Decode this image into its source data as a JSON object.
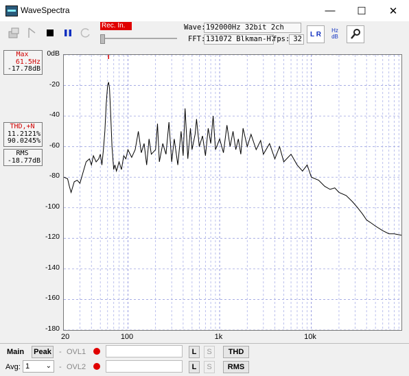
{
  "window": {
    "title": "WaveSpectra",
    "minimize": "—",
    "maximize": "☐",
    "close": "✕"
  },
  "toolbar": {
    "rec_in_label": "Rec. In.",
    "wave_label": "Wave:",
    "wave_value": "192000Hz 32bit 2ch",
    "fft_label": "FFT:",
    "fft_value": "131072 Blkman-H7",
    "fps_label": "fps:",
    "fps_value": "32",
    "lr_label": "L R",
    "hzdb_label": "Hz dB"
  },
  "side": {
    "max_header": "Max",
    "max_freq": "61.5Hz",
    "max_level": "-17.78dB",
    "thd_header": "THD,+N",
    "thd_value1": "11.2121%",
    "thd_value2": "90.0245%",
    "rms_header": "RMS",
    "rms_value": "-18.77dB"
  },
  "bottom": {
    "main_label": "Main",
    "peak_label": "Peak",
    "avg_label": "Avg:",
    "avg_value": "1",
    "dash1": "-",
    "dash2": "-",
    "ovl1_label": "OVL1",
    "ovl2_label": "OVL2",
    "l_label1": "L",
    "s_label1": "S",
    "l_label2": "L",
    "s_label2": "S",
    "thd_label": "THD",
    "rms_label": "RMS"
  },
  "chart_data": {
    "type": "line",
    "title": "",
    "xlabel": "",
    "ylabel": "",
    "x_scale": "log",
    "xlim": [
      20,
      96000
    ],
    "ylim": [
      -180,
      0
    ],
    "x_tick_labels": [
      "20",
      "100",
      "1k",
      "10k"
    ],
    "x_ticks": [
      20,
      100,
      1000,
      10000
    ],
    "y_ticks": [
      0,
      -20,
      -40,
      -60,
      -80,
      -100,
      -120,
      -140,
      -160,
      -180
    ],
    "y_tick_labels": [
      "0dB",
      "-20",
      "-40",
      "-60",
      "-80",
      "-100",
      "-120",
      "-140",
      "-160",
      "-180"
    ],
    "grid": true,
    "peak_marker_freq": 61.5,
    "series": [
      {
        "color": "#000000",
        "points": [
          [
            20,
            -80
          ],
          [
            22,
            -81
          ],
          [
            23,
            -86
          ],
          [
            24,
            -90
          ],
          [
            26,
            -83
          ],
          [
            28,
            -82
          ],
          [
            30,
            -84
          ],
          [
            32,
            -78
          ],
          [
            35,
            -70
          ],
          [
            38,
            -68
          ],
          [
            40,
            -72
          ],
          [
            42,
            -66
          ],
          [
            45,
            -70
          ],
          [
            48,
            -68
          ],
          [
            50,
            -65
          ],
          [
            52,
            -72
          ],
          [
            54,
            -62
          ],
          [
            56,
            -50
          ],
          [
            58,
            -32
          ],
          [
            60,
            -20
          ],
          [
            61.5,
            -17.8
          ],
          [
            63,
            -22
          ],
          [
            65,
            -40
          ],
          [
            67,
            -60
          ],
          [
            70,
            -75
          ],
          [
            72,
            -72
          ],
          [
            75,
            -76
          ],
          [
            80,
            -70
          ],
          [
            85,
            -75
          ],
          [
            90,
            -66
          ],
          [
            95,
            -68
          ],
          [
            100,
            -62
          ],
          [
            110,
            -67
          ],
          [
            120,
            -62
          ],
          [
            130,
            -50
          ],
          [
            140,
            -64
          ],
          [
            150,
            -58
          ],
          [
            160,
            -72
          ],
          [
            170,
            -55
          ],
          [
            180,
            -65
          ],
          [
            200,
            -62
          ],
          [
            210,
            -45
          ],
          [
            220,
            -70
          ],
          [
            240,
            -58
          ],
          [
            260,
            -65
          ],
          [
            280,
            -44
          ],
          [
            300,
            -70
          ],
          [
            320,
            -55
          ],
          [
            350,
            -72
          ],
          [
            380,
            -50
          ],
          [
            400,
            -66
          ],
          [
            420,
            -35
          ],
          [
            450,
            -68
          ],
          [
            480,
            -48
          ],
          [
            500,
            -62
          ],
          [
            540,
            -52
          ],
          [
            560,
            -42
          ],
          [
            600,
            -60
          ],
          [
            650,
            -53
          ],
          [
            700,
            -66
          ],
          [
            750,
            -48
          ],
          [
            800,
            -58
          ],
          [
            850,
            -40
          ],
          [
            900,
            -62
          ],
          [
            1000,
            -55
          ],
          [
            1100,
            -64
          ],
          [
            1200,
            -46
          ],
          [
            1300,
            -60
          ],
          [
            1400,
            -50
          ],
          [
            1500,
            -62
          ],
          [
            1600,
            -55
          ],
          [
            1700,
            -65
          ],
          [
            1800,
            -48
          ],
          [
            2000,
            -60
          ],
          [
            2200,
            -52
          ],
          [
            2500,
            -62
          ],
          [
            2800,
            -56
          ],
          [
            3000,
            -65
          ],
          [
            3500,
            -58
          ],
          [
            4000,
            -68
          ],
          [
            4500,
            -60
          ],
          [
            5000,
            -70
          ],
          [
            6000,
            -65
          ],
          [
            7000,
            -72
          ],
          [
            8000,
            -76
          ],
          [
            9000,
            -72
          ],
          [
            10000,
            -80
          ],
          [
            12000,
            -82
          ],
          [
            14000,
            -86
          ],
          [
            16000,
            -88
          ],
          [
            18000,
            -87
          ],
          [
            20000,
            -90
          ],
          [
            24000,
            -92
          ],
          [
            28000,
            -96
          ],
          [
            32000,
            -100
          ],
          [
            36000,
            -104
          ],
          [
            40000,
            -108
          ],
          [
            45000,
            -110
          ],
          [
            50000,
            -112
          ],
          [
            60000,
            -115
          ],
          [
            70000,
            -117
          ],
          [
            80000,
            -117
          ],
          [
            96000,
            -118
          ]
        ]
      }
    ]
  }
}
